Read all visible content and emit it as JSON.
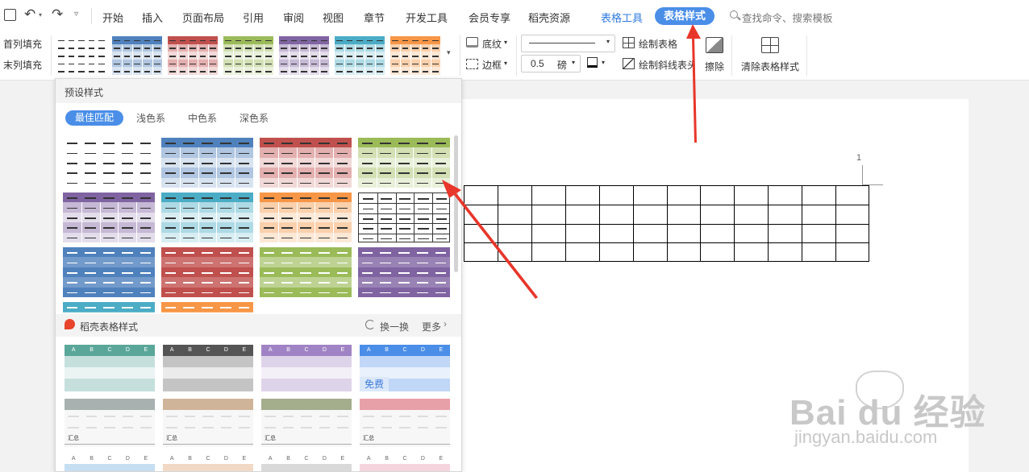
{
  "menu": {
    "items": [
      "开始",
      "插入",
      "页面布局",
      "引用",
      "审阅",
      "视图",
      "章节",
      "开发工具",
      "会员专享",
      "稻壳资源"
    ],
    "table_tools": "表格工具",
    "table_style": "表格样式",
    "search_placeholder": "查找命令、搜索模板"
  },
  "ribbon": {
    "first_col": "首列填充",
    "last_col": "末列填充",
    "shading": "底纹",
    "border": "边框",
    "pen_weight": "0.5",
    "pen_unit": "磅",
    "draw_table": "绘制表格",
    "draw_diag": "绘制斜线表头",
    "erase": "擦除",
    "clear_style": "清除表格样式"
  },
  "panel": {
    "header": "预设样式",
    "tabs": [
      "最佳匹配",
      "浅色系",
      "中色系",
      "深色系"
    ],
    "daoke_title": "稻壳表格样式",
    "refresh": "换一换",
    "more": "更多",
    "free_badge": "免费",
    "summary_label": "汇总",
    "col_letters": [
      "A",
      "B",
      "C",
      "D",
      "E"
    ]
  },
  "document": {
    "page_number": "1"
  },
  "watermark": {
    "brand": "Bai du 经验",
    "url": "jingyan.baidu.com"
  },
  "colors": {
    "accent": "#4a8ee8",
    "blue": "#4f81bd",
    "red": "#c0504d",
    "green": "#9bbb59",
    "purple": "#8064a2",
    "teal": "#4bacc6",
    "orange": "#f79646",
    "arrow": "#e8362a"
  }
}
